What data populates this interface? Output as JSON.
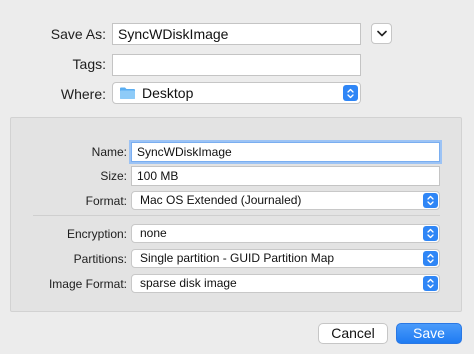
{
  "save_as": {
    "label": "Save As:",
    "value": "SyncWDiskImage"
  },
  "tags": {
    "label": "Tags:",
    "value": ""
  },
  "where": {
    "label": "Where:",
    "value": "Desktop"
  },
  "form": {
    "name": {
      "label": "Name:",
      "value": "SyncWDiskImage"
    },
    "size": {
      "label": "Size:",
      "value": "100 MB"
    },
    "format": {
      "label": "Format:",
      "value": "Mac OS Extended (Journaled)"
    },
    "encryption": {
      "label": "Encryption:",
      "value": "none"
    },
    "partitions": {
      "label": "Partitions:",
      "value": "Single partition - GUID Partition Map"
    },
    "image_format": {
      "label": "Image Format:",
      "value": "sparse disk image"
    }
  },
  "buttons": {
    "cancel": "Cancel",
    "save": "Save"
  },
  "colors": {
    "accent": "#2f86f6",
    "focus_ring": "#9cc3f5",
    "window_bg": "#ececec",
    "panel_bg": "#e3e3e3"
  },
  "icons": [
    "chevron-down-icon",
    "folder-icon",
    "stepper-icon"
  ]
}
